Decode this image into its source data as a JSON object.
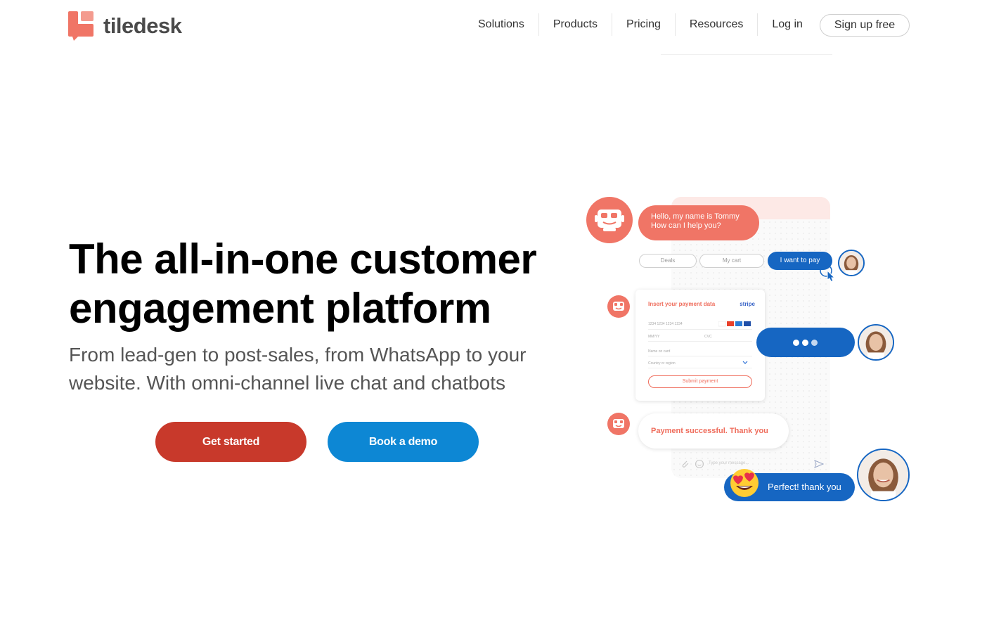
{
  "brand": {
    "name": "tiledesk",
    "color": "#f07566"
  },
  "nav": {
    "items": [
      "Solutions",
      "Products",
      "Pricing",
      "Resources",
      "Log in"
    ],
    "signup_label": "Sign up free"
  },
  "hero": {
    "title": "The all-in-one customer engagement platform",
    "subtitle": "From lead-gen to post-sales, from WhatsApp to your website. With omni-channel live chat and chatbots",
    "primary_cta": "Get started",
    "secondary_cta": "Book a demo",
    "primary_color": "#c8392b",
    "secondary_color": "#0d87d4"
  },
  "chat_demo": {
    "bot_greeting_line1": "Hello, my name is Tommy",
    "bot_greeting_line2": "How can I help you?",
    "quick_replies": [
      "Deals",
      "My cart",
      "I want to pay"
    ],
    "payment_card": {
      "title": "Insert your payment data",
      "provider": "stripe",
      "card_number_placeholder": "1234 1234 1234 1234",
      "expiry_placeholder": "MM/YY",
      "cvc_placeholder": "CVC",
      "name_placeholder": "Name on card",
      "country_placeholder": "Country or region",
      "submit_label": "Submit payment"
    },
    "bot_success": "Payment successful. Thank you",
    "composer_placeholder": "Type your message...",
    "user_reply": "Perfect! thank you",
    "user_color": "#1666c2"
  }
}
